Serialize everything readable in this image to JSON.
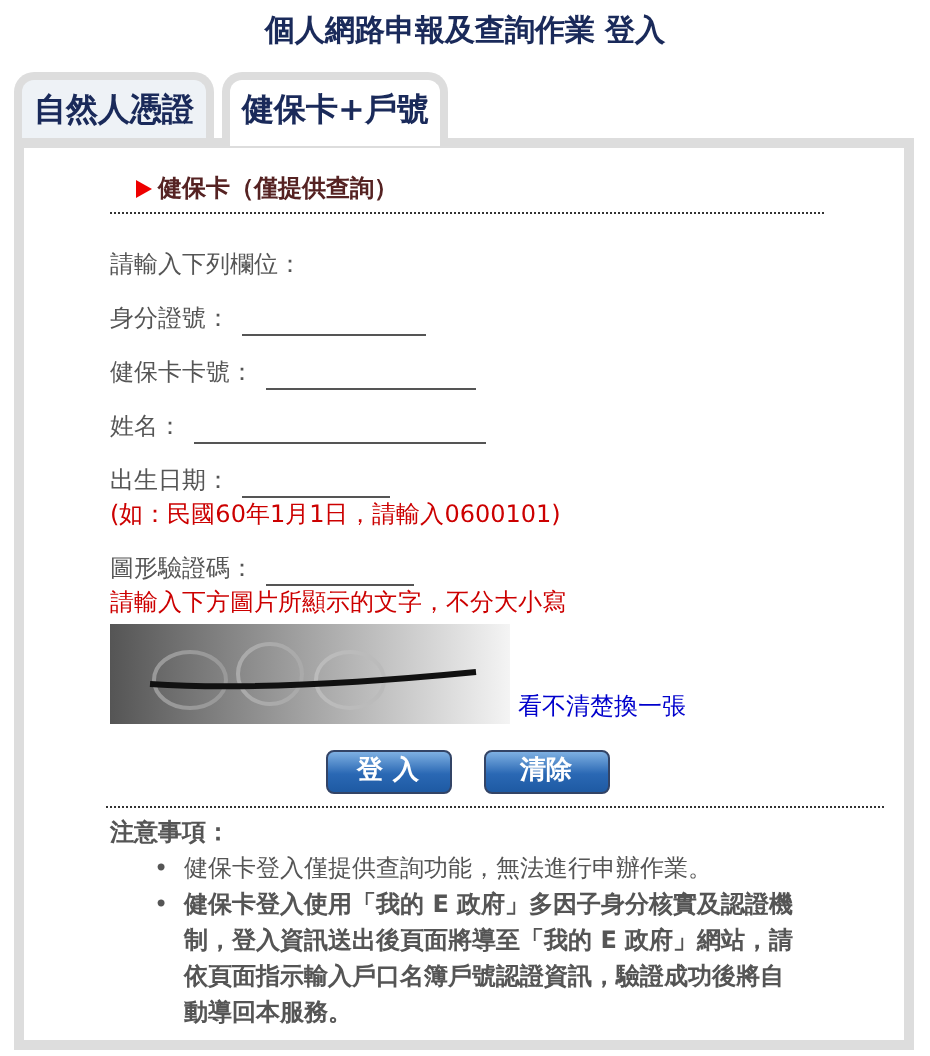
{
  "title": "個人網路申報及查詢作業 登入",
  "tabs": [
    {
      "label": "自然人憑證",
      "selected": false
    },
    {
      "label": "健保卡+戶號",
      "selected": true
    }
  ],
  "section_heading": "健保卡（僅提供查詢）",
  "prompt": "請輸入下列欄位：",
  "fields": [
    {
      "label": "身分證號："
    },
    {
      "label": "健保卡卡號："
    },
    {
      "label": "姓名："
    },
    {
      "label": "出生日期：",
      "note": "(如：民國60年1月1日，請輸入0600101)"
    },
    {
      "label": "圖形驗證碼：",
      "note": "請輸入下方圖片所顯示的文字，不分大小寫"
    }
  ],
  "captcha": {
    "kind": "picture",
    "refresh_link": "看不清楚換一張"
  },
  "buttons": [
    "登 入",
    "清除"
  ],
  "notes": {
    "title": "注意事項：",
    "items": [
      {
        "bullet": "•",
        "text": "健保卡登入僅提供查詢功能，無法進行申辦作業。",
        "bold": false
      },
      {
        "bullet": "•",
        "text": "健保卡登入使用「我的 E 政府」多因子身分核實及認證機制，登入資訊送出後頁面將導至「我的 E 政府」網站，請依頁面指示輸入戶口名簿戶號認證資訊，驗證成功後將自動導回本服務。",
        "bold": true
      }
    ]
  }
}
